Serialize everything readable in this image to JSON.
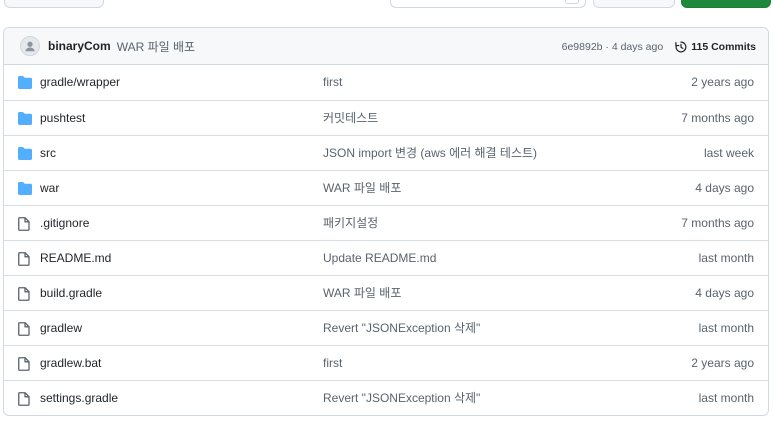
{
  "colors": {
    "folder": "#54aeff",
    "file_icon": "#59636e",
    "border": "#d1d9e0",
    "header_bg": "#f6f8fa",
    "green_button": "#1f883d"
  },
  "latest_commit": {
    "author": "binaryCom",
    "message": "WAR 파일 배포",
    "sha_time": "6e9892b · 4 days ago",
    "commits_label": "115 Commits",
    "history_icon": "history-icon",
    "avatar_icon": "avatar-icon"
  },
  "files": [
    {
      "type": "folder",
      "name": "gradle/wrapper",
      "message": "first",
      "age": "2 years ago"
    },
    {
      "type": "folder",
      "name": "pushtest",
      "message": "커밋테스트",
      "age": "7 months ago"
    },
    {
      "type": "folder",
      "name": "src",
      "message": "JSON import 변경 (aws 에러 해결 테스트)",
      "age": "last week"
    },
    {
      "type": "folder",
      "name": "war",
      "message": "WAR 파일 배포",
      "age": "4 days ago"
    },
    {
      "type": "file",
      "name": ".gitignore",
      "message": "패키지설정",
      "age": "7 months ago"
    },
    {
      "type": "file",
      "name": "README.md",
      "message": "Update README.md",
      "age": "last month"
    },
    {
      "type": "file",
      "name": "build.gradle",
      "message": "WAR 파일 배포",
      "age": "4 days ago"
    },
    {
      "type": "file",
      "name": "gradlew",
      "message": "Revert \"JSONException 삭제\"",
      "age": "last month"
    },
    {
      "type": "file",
      "name": "gradlew.bat",
      "message": "first",
      "age": "2 years ago"
    },
    {
      "type": "file",
      "name": "settings.gradle",
      "message": "Revert \"JSONException 삭제\"",
      "age": "last month"
    }
  ]
}
